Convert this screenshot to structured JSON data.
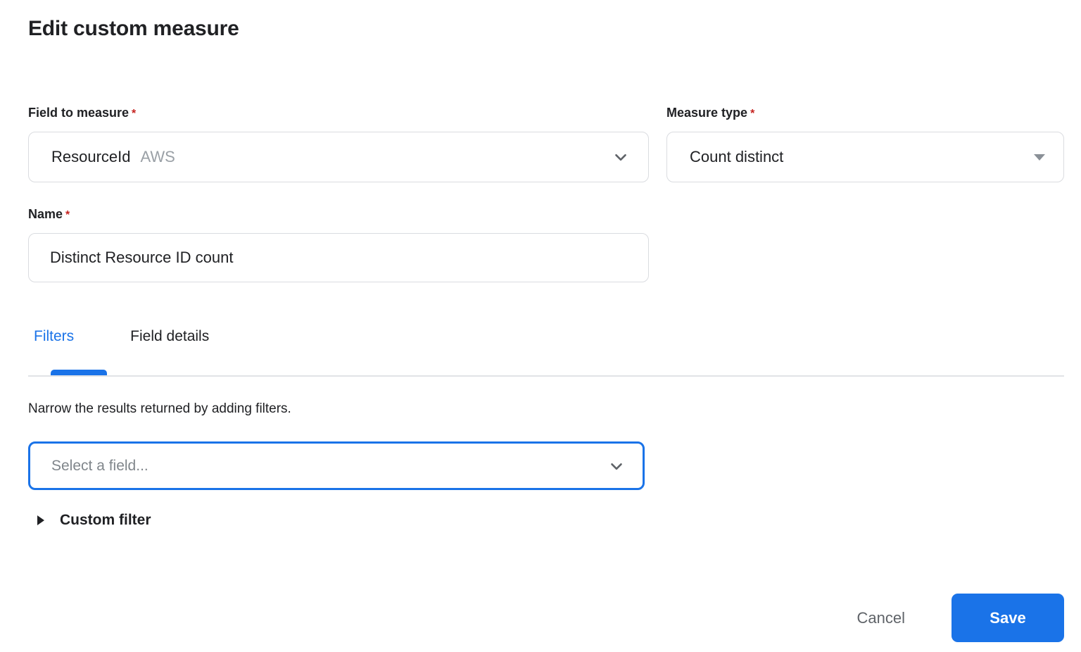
{
  "page": {
    "title": "Edit custom measure"
  },
  "form": {
    "field_to_measure": {
      "label": "Field to measure",
      "required_marker": "*",
      "value": "ResourceId",
      "value_tag": "AWS"
    },
    "measure_type": {
      "label": "Measure type",
      "required_marker": "*",
      "value": "Count distinct"
    },
    "name": {
      "label": "Name",
      "required_marker": "*",
      "value": "Distinct Resource ID count"
    }
  },
  "tabs": [
    {
      "label": "Filters",
      "active": true
    },
    {
      "label": "Field details",
      "active": false
    }
  ],
  "filters": {
    "description": "Narrow the results returned by adding filters.",
    "field_select_placeholder": "Select a field...",
    "custom_filter_label": "Custom filter"
  },
  "footer": {
    "cancel_label": "Cancel",
    "save_label": "Save"
  },
  "icons": {
    "field_dropdown": "chevron-down-icon",
    "measure_dropdown": "caret-down-icon",
    "filter_dropdown": "chevron-down-icon",
    "custom_filter": "triangle-right-icon"
  },
  "colors": {
    "accent_blue": "#1a73e8",
    "required_red": "#c5221f",
    "border_gray": "#dadce0",
    "muted_text": "#9aa0a6",
    "cancel_text": "#5f6368"
  }
}
